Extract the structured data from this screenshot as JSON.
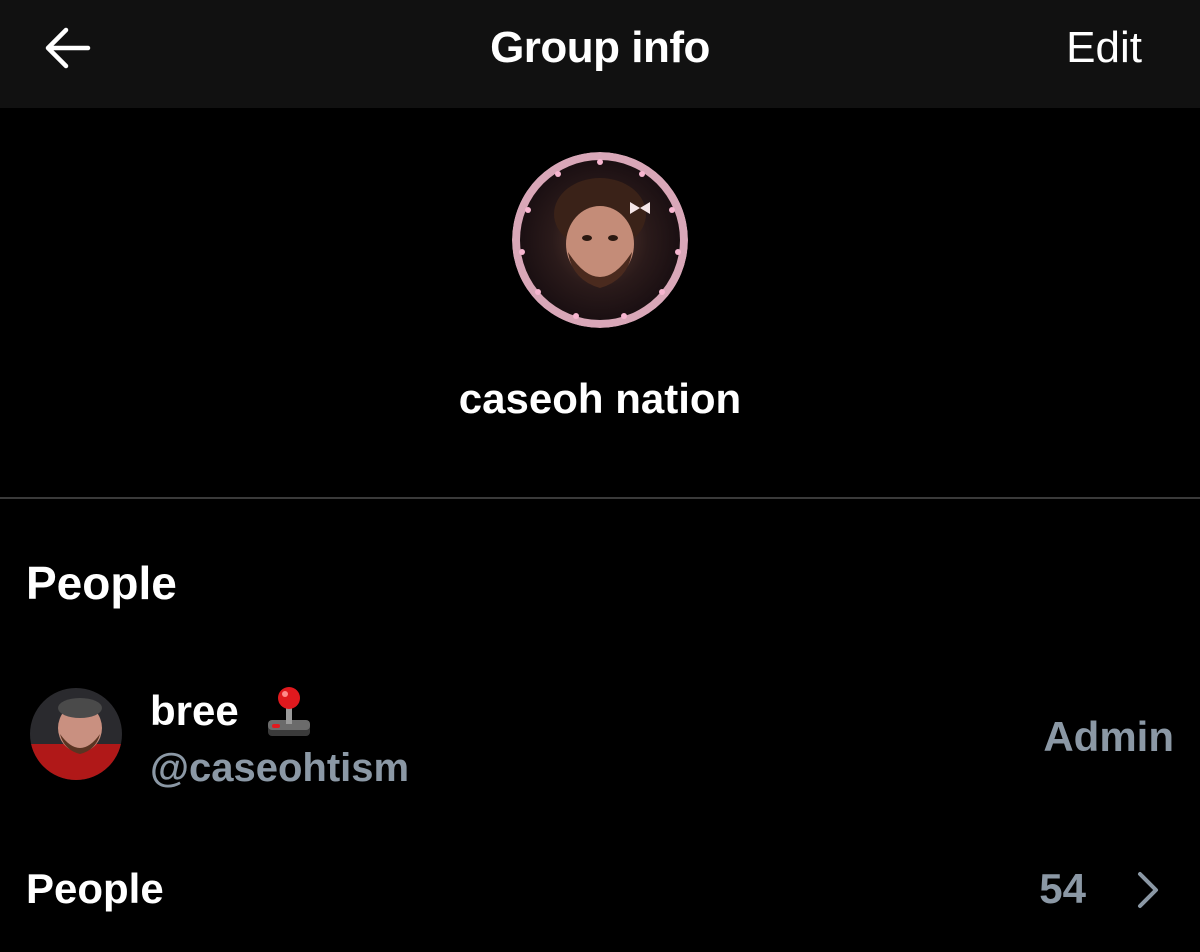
{
  "header": {
    "title": "Group info",
    "edit_label": "Edit",
    "back_icon": "arrow-left-icon"
  },
  "group": {
    "name": "caseoh nation",
    "avatar_icon": "group-avatar"
  },
  "people_section": {
    "title": "People",
    "members": [
      {
        "name": "bree",
        "emoji": "joystick-icon",
        "handle": "@caseohtism",
        "role": "Admin"
      }
    ]
  },
  "people_link": {
    "label": "People",
    "count": "54",
    "chevron_icon": "chevron-right-icon"
  },
  "colors": {
    "background": "#000000",
    "header_background": "#111111",
    "text_primary": "#ffffff",
    "text_secondary": "#8b98a5",
    "divider": "#3a3a3a"
  }
}
